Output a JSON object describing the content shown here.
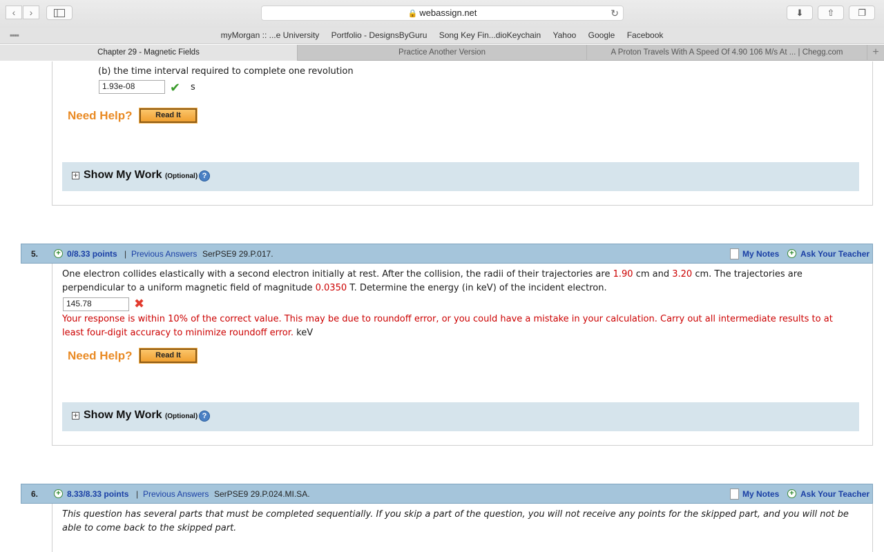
{
  "browser": {
    "url": "webassign.net",
    "favorites": [
      "myMorgan :: ...e University",
      "Portfolio - DesignsByGuru",
      "Song Key Fin...dioKeychain",
      "Yahoo",
      "Google",
      "Facebook"
    ],
    "tabs": [
      "Chapter 29 - Magnetic Fields",
      "Practice Another Version",
      "A Proton Travels With A Speed Of 4.90 106 M/s At ... | Chegg.com"
    ],
    "icons": {
      "back": "‹",
      "forward": "›",
      "reload": "↻",
      "download": "⬇",
      "share": "⇧",
      "tabs": "❐",
      "newtab": "+",
      "lock": "🔒"
    }
  },
  "part_b": {
    "prompt": "(b) the time interval required to complete one revolution",
    "answer": "1.93e-08",
    "unit": "s"
  },
  "help": {
    "need_help": "Need Help?",
    "read_it": "Read It"
  },
  "show_my_work": {
    "title": "Show My Work",
    "optional": "(Optional)",
    "q": "?"
  },
  "q5": {
    "number": "5.",
    "points": "0/8.33 points",
    "sep": "|",
    "previous": "Previous Answers",
    "code": "SerPSE9 29.P.017.",
    "my_notes": "My Notes",
    "ask": "Ask Your Teacher",
    "text_1": "One electron collides elastically with a second electron initially at rest. After the collision, the radii of their trajectories are",
    "val_1": "1.90",
    "text_2": "cm and",
    "val_2": "3.20",
    "text_3": "cm. The trajectories are",
    "text_4": "perpendicular to a uniform magnetic field of magnitude",
    "val_3": "0.0350",
    "text_5": "T. Determine the energy (in keV) of the incident electron.",
    "answer": "145.78",
    "feedback_1": "Your response is within 10% of the correct value. This may be due to roundoff error, or you could have a mistake in your calculation. Carry out all intermediate results to at",
    "feedback_2": "least four-digit accuracy to minimize roundoff error.",
    "unit": "keV"
  },
  "q6": {
    "number": "6.",
    "points": "8.33/8.33 points",
    "sep": "|",
    "previous": "Previous Answers",
    "code": "SerPSE9 29.P.024.MI.SA.",
    "my_notes": "My Notes",
    "ask": "Ask Your Teacher",
    "text_1": "This question has several parts that must be completed sequentially. If you skip a part of the question, you will not receive any points for the skipped part, and you will not be",
    "text_2": "able to come back to the skipped part."
  }
}
